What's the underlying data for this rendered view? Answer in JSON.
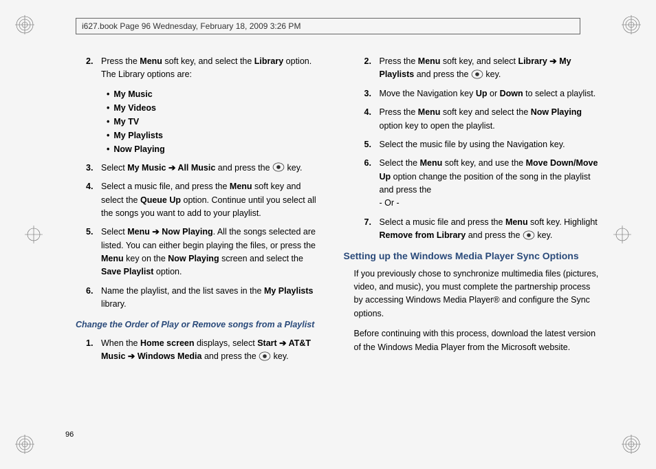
{
  "header": "i627.book  Page 96  Wednesday, February 18, 2009  3:26 PM",
  "page_number": "96",
  "left": {
    "item2_pre": "Press the ",
    "item2_b1": "Menu",
    "item2_mid1": " soft key, and select the ",
    "item2_b2": "Library",
    "item2_mid2": " option. The Library options are:",
    "bullets": {
      "b1": "My Music",
      "b2": "My Videos",
      "b3": "My TV",
      "b4": "My Playlists",
      "b5": "Now Playing"
    },
    "item3_pre": "Select ",
    "item3_b1": "My Music ➔ All Music",
    "item3_mid": " and press the ",
    "item3_post": " key.",
    "item4_pre": "Select a music file, and press the ",
    "item4_b1": "Menu",
    "item4_mid1": " soft key and select the ",
    "item4_b2": "Queue Up",
    "item4_post": " option. Continue until you select all the songs you want to add to your playlist.",
    "item5_pre": "Select ",
    "item5_b1": "Menu ➔ Now Playing",
    "item5_mid1": ". All the songs selected are listed. You can either begin playing the files, or press the ",
    "item5_b2": "Menu",
    "item5_mid2": " key on the ",
    "item5_b3": "Now Playing",
    "item5_mid3": " screen and select the ",
    "item5_b4": "Save Playlist",
    "item5_post": " option.",
    "item6_pre": "Name the playlist, and the list saves in the ",
    "item6_b1": "My Playlists",
    "item6_post": " library.",
    "subheading": "Change the Order of Play or Remove songs from a Playlist",
    "item1b_pre": "When the ",
    "item1b_b1": "Home screen",
    "item1b_mid1": " displays, select ",
    "item1b_b2": "Start ➔ AT&T Music ➔ Windows Media",
    "item1b_mid2": " and press the ",
    "item1b_post": " key."
  },
  "right": {
    "item2_pre": "Press the ",
    "item2_b1": "Menu",
    "item2_mid1": " soft key, and select ",
    "item2_b2": "Library ➔ My Playlists",
    "item2_mid2": " and press the ",
    "item2_post": " key.",
    "item3_pre": "Move the Navigation key ",
    "item3_b1": "Up",
    "item3_mid": " or ",
    "item3_b2": "Down",
    "item3_post": " to select a playlist.",
    "item4_pre": "Press the ",
    "item4_b1": "Menu",
    "item4_mid": " soft key and select the ",
    "item4_b2": "Now Playing",
    "item4_post": " option key to open the playlist.",
    "item5": "Select the music file by using the Navigation key.",
    "item6_pre": "Select the ",
    "item6_b1": "Menu",
    "item6_mid": " soft key, and use the ",
    "item6_b2": "Move Down/Move Up",
    "item6_post": " option change the position of the song in the playlist and press the",
    "or": "- Or -",
    "item7_pre": "Select a music file and press the ",
    "item7_b1": "Menu",
    "item7_mid1": " soft key. Highlight ",
    "item7_b2": "Remove from Library",
    "item7_mid2": " and press the ",
    "item7_post": " key.",
    "heading": "Setting up the Windows Media Player Sync Options",
    "para1": "If you previously chose to synchronize multimedia files (pictures, video, and music), you must complete the partnership process by accessing Windows Media Player® and configure the Sync options.",
    "para2": "Before continuing with this process, download the latest version of the Windows Media Player from the Microsoft website."
  },
  "nums": {
    "n1": "1.",
    "n2": "2.",
    "n3": "3.",
    "n4": "4.",
    "n5": "5.",
    "n6": "6.",
    "n7": "7."
  }
}
